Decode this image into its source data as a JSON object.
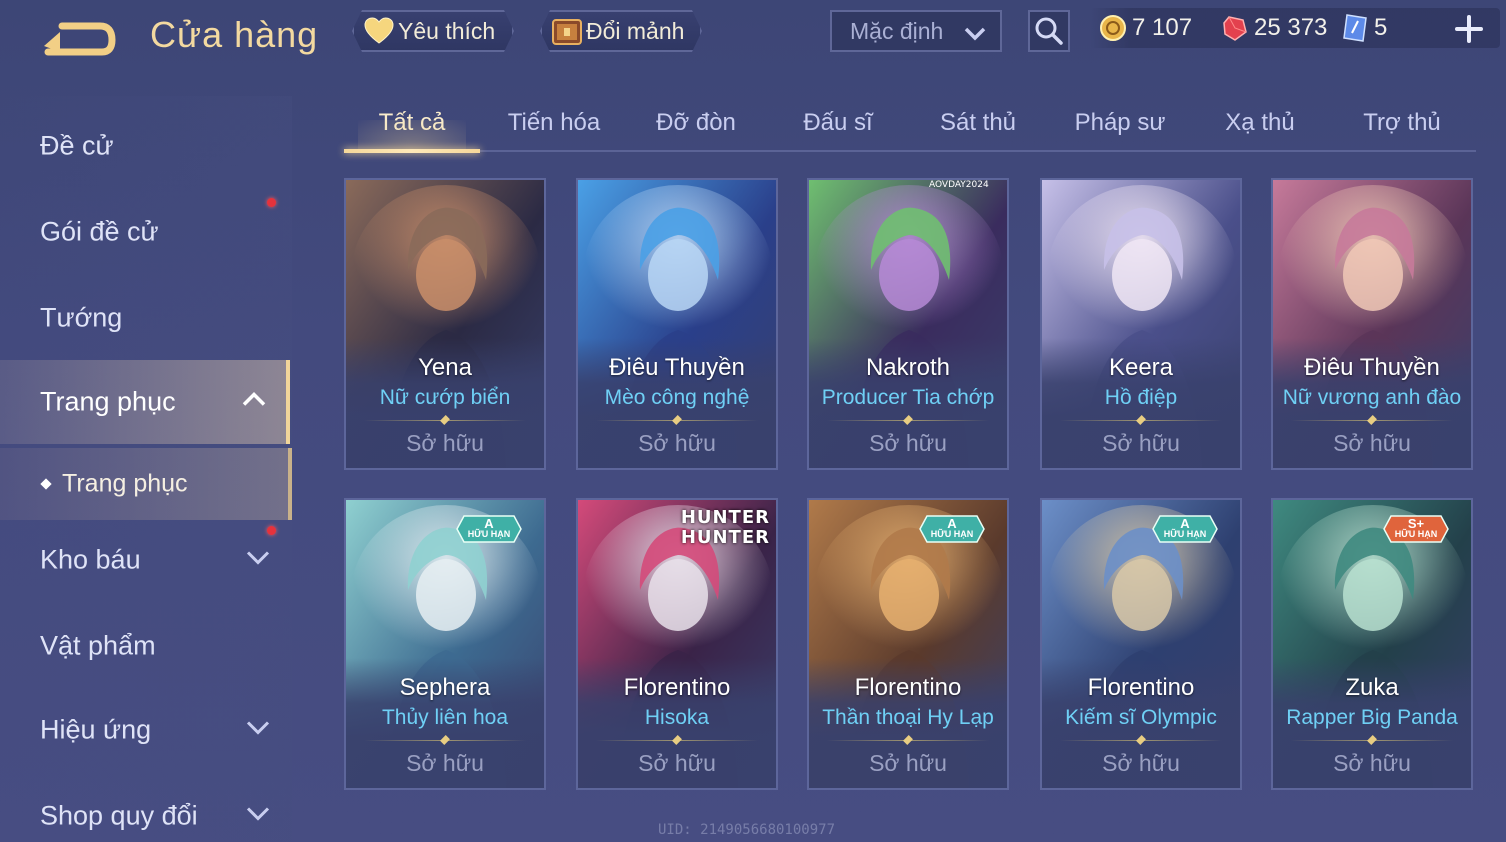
{
  "header": {
    "title": "Cửa hàng",
    "favorites_label": "Yêu thích",
    "trade_label": "Đổi mảnh",
    "sort": {
      "selected": "Mặc định"
    },
    "currencies": [
      {
        "name": "gold-coin",
        "value": "7 107"
      },
      {
        "name": "ruby-gem",
        "value": "25 373"
      },
      {
        "name": "voucher",
        "value": "5"
      }
    ]
  },
  "sidebar": {
    "items": [
      {
        "label": "Đề cử",
        "dot": false
      },
      {
        "label": "Gói đề cử",
        "dot": true
      },
      {
        "label": "Tướng",
        "dot": false
      },
      {
        "label": "Trang phục",
        "active": true,
        "expanded": true
      },
      {
        "label": "Trang phục",
        "sub": true
      },
      {
        "label": "Kho báu",
        "dot": true,
        "expandable": true
      },
      {
        "label": "Vật phẩm"
      },
      {
        "label": "Hiệu ứng",
        "expandable": true
      },
      {
        "label": "Shop quy đổi",
        "expandable": true
      }
    ]
  },
  "tabs": [
    "Tất cả",
    "Tiến hóa",
    "Đỡ đòn",
    "Đấu sĩ",
    "Sát thủ",
    "Pháp sư",
    "Xạ thủ",
    "Trợ thủ"
  ],
  "active_tab": "Tất cả",
  "cards": [
    {
      "hero": "Yena",
      "skin": "Nữ cướp biển",
      "status": "Sở hữu",
      "badge": null,
      "palette": [
        "#2b2a44",
        "#8a6a5a",
        "#c98e6a"
      ]
    },
    {
      "hero": "Điêu Thuyền",
      "skin": "Mèo công nghệ",
      "status": "Sở hữu",
      "badge": null,
      "palette": [
        "#2a3f8a",
        "#4aa0e6",
        "#b9d6f5"
      ]
    },
    {
      "hero": "Nakroth",
      "skin": "Producer Tia chớp",
      "status": "Sở hữu",
      "badge": null,
      "badge_text": "AOVDAY2024",
      "palette": [
        "#3a2c5e",
        "#6fbf70",
        "#b68ad6"
      ]
    },
    {
      "hero": "Keera",
      "skin": "Hồ điệp",
      "status": "Sở hữu",
      "badge": null,
      "palette": [
        "#4a4f8a",
        "#c6c0e8",
        "#f0e6f4"
      ]
    },
    {
      "hero": "Điêu Thuyền",
      "skin": "Nữ vương anh đào",
      "status": "Sở hữu",
      "badge": null,
      "palette": [
        "#5a3558",
        "#c67a9a",
        "#f0c8b6"
      ]
    },
    {
      "hero": "Sephera",
      "skin": "Thủy liên hoa",
      "status": "Sở hữu",
      "badge": {
        "tier": "A",
        "text": "HỮU HẠN",
        "color": "#3fb0a6"
      },
      "palette": [
        "#3d6a90",
        "#8fd0d0",
        "#e6eef2"
      ]
    },
    {
      "hero": "Florentino",
      "skin": "Hisoka",
      "status": "Sở hữu",
      "badge": null,
      "logo": "HUNTER HUNTER",
      "palette": [
        "#3a2348",
        "#d44a7a",
        "#e8e0ea"
      ]
    },
    {
      "hero": "Florentino",
      "skin": "Thần thoại Hy Lạp",
      "status": "Sở hữu",
      "badge": {
        "tier": "A",
        "text": "HỮU HẠN",
        "color": "#3fb0a6"
      },
      "palette": [
        "#5a3a2c",
        "#b07a4a",
        "#e6b070"
      ]
    },
    {
      "hero": "Florentino",
      "skin": "Kiếm sĩ Olympic",
      "status": "Sở hữu",
      "badge": {
        "tier": "A",
        "text": "HỮU HẠN",
        "color": "#3fb0a6"
      },
      "palette": [
        "#2e4070",
        "#6c8fc8",
        "#d8c8a8"
      ]
    },
    {
      "hero": "Zuka",
      "skin": "Rapper Big Panda",
      "status": "Sở hữu",
      "badge": {
        "tier": "S+",
        "text": "HỮU HẠN",
        "color": "#e0643c"
      },
      "palette": [
        "#23404a",
        "#3f8a80",
        "#b8e0d0"
      ]
    }
  ],
  "uid_text": "UID: 2149056680100977"
}
